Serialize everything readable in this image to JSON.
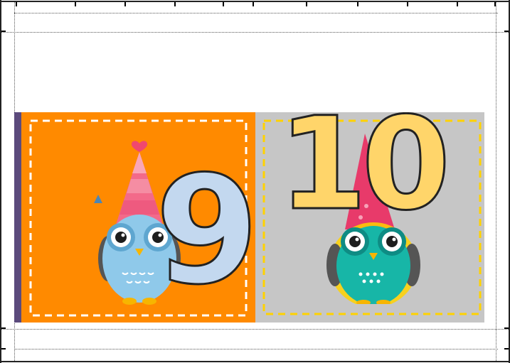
{
  "cards": [
    {
      "number": "9",
      "background": "#FF8A00",
      "dash_color": "#FFFFFF",
      "number_color": "#C3D8EF",
      "owl_body": "#8FC9EA",
      "hat_color": "#F36A8A"
    },
    {
      "number": "10",
      "background": "#C6C6C6",
      "dash_color": "#FFD200",
      "number_color": "#FFD56A",
      "owl_body": "#17B6A7",
      "hat_color": "#E83A6A"
    }
  ],
  "accent_strip": "#5B4A7C",
  "icons": [
    "owl-9-illustration",
    "owl-10-illustration",
    "heart-icon"
  ]
}
